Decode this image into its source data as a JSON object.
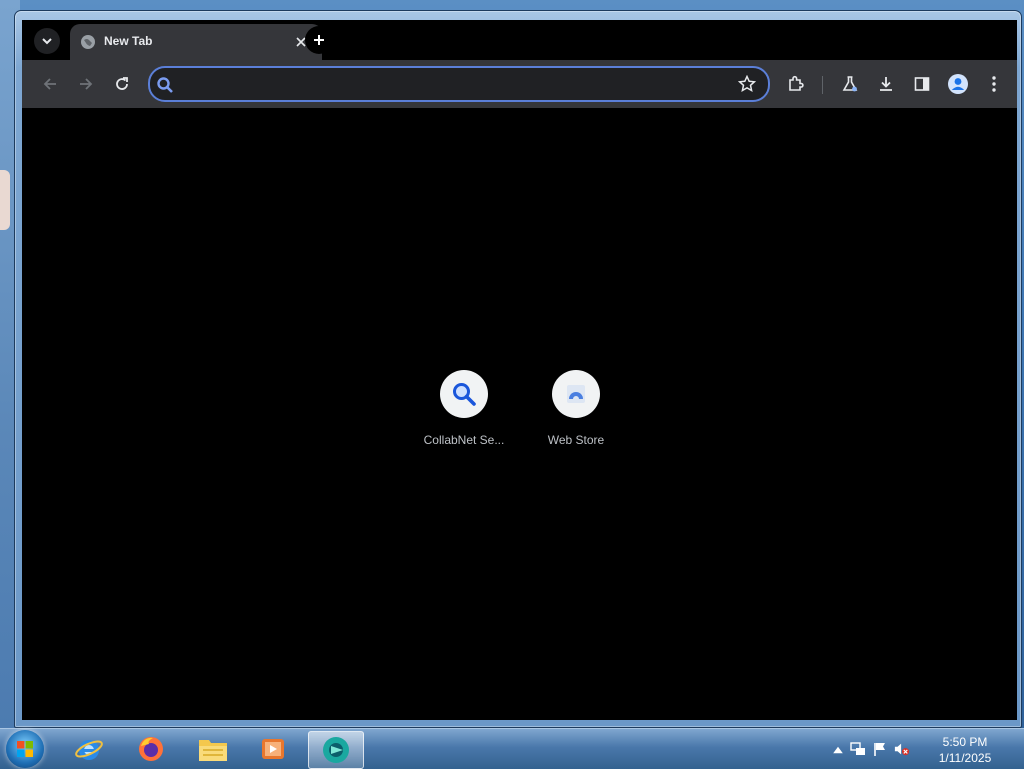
{
  "window": {
    "caption_buttons": {
      "minimize": "minimize-icon",
      "maximize": "maximize-icon",
      "close": "close-icon"
    }
  },
  "browser": {
    "tab": {
      "title": "New Tab",
      "favicon": "globe-icon"
    },
    "toolbar": {
      "omnibox": {
        "value": "",
        "placeholder": ""
      },
      "icons": [
        "back-icon",
        "forward-icon",
        "reload-icon",
        "bookmark-star-icon",
        "extensions-icon",
        "labs-flask-icon",
        "download-icon",
        "side-panel-icon",
        "profile-icon",
        "menu-icon"
      ]
    },
    "accent_color": "#5b7fd8"
  },
  "new_tab": {
    "shortcuts": [
      {
        "label": "CollabNet Se...",
        "icon": "search-icon"
      },
      {
        "label": "Web Store",
        "icon": "web-store-icon"
      }
    ]
  },
  "taskbar": {
    "apps": [
      "internet-explorer-icon",
      "firefox-icon",
      "file-explorer-icon",
      "media-player-icon",
      "chrome-app-icon"
    ],
    "clock": {
      "time": "5:50 PM",
      "date": "1/11/2025"
    }
  }
}
